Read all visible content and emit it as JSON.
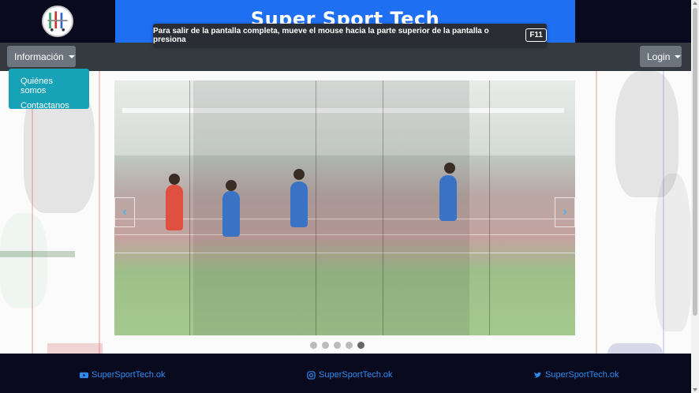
{
  "header": {
    "brand_title": "Super Sport Tech",
    "logo_icon": "trophy-logo-icon"
  },
  "fullscreen_notice": {
    "text": "Para salir de la pantalla completa, mueve el mouse hacia la parte superior de la pantalla o presiona",
    "key": "F11"
  },
  "navbar": {
    "info_label": "Información",
    "login_label": "Login"
  },
  "dropdown": {
    "items": [
      {
        "label": "Quiénes somos"
      },
      {
        "label": "Contactanos"
      }
    ]
  },
  "carousel": {
    "prev_icon": "chevron-left-icon",
    "next_icon": "chevron-right-icon",
    "prev_glyph": "‹",
    "next_glyph": "›",
    "slide_count": 5,
    "active_index": 4
  },
  "footer": {
    "youtube": "SuperSportTech.ok",
    "instagram": "SuperSportTech.ok",
    "twitter": "SuperSportTech.ok"
  },
  "colors": {
    "header_bg": "#0a0a1f",
    "brand_blue": "#1f6ff2",
    "navbar_bg": "#343a40",
    "button_gray": "#6c757d",
    "dropdown_teal": "#17a2b8",
    "link_blue": "#2f8bf0"
  }
}
